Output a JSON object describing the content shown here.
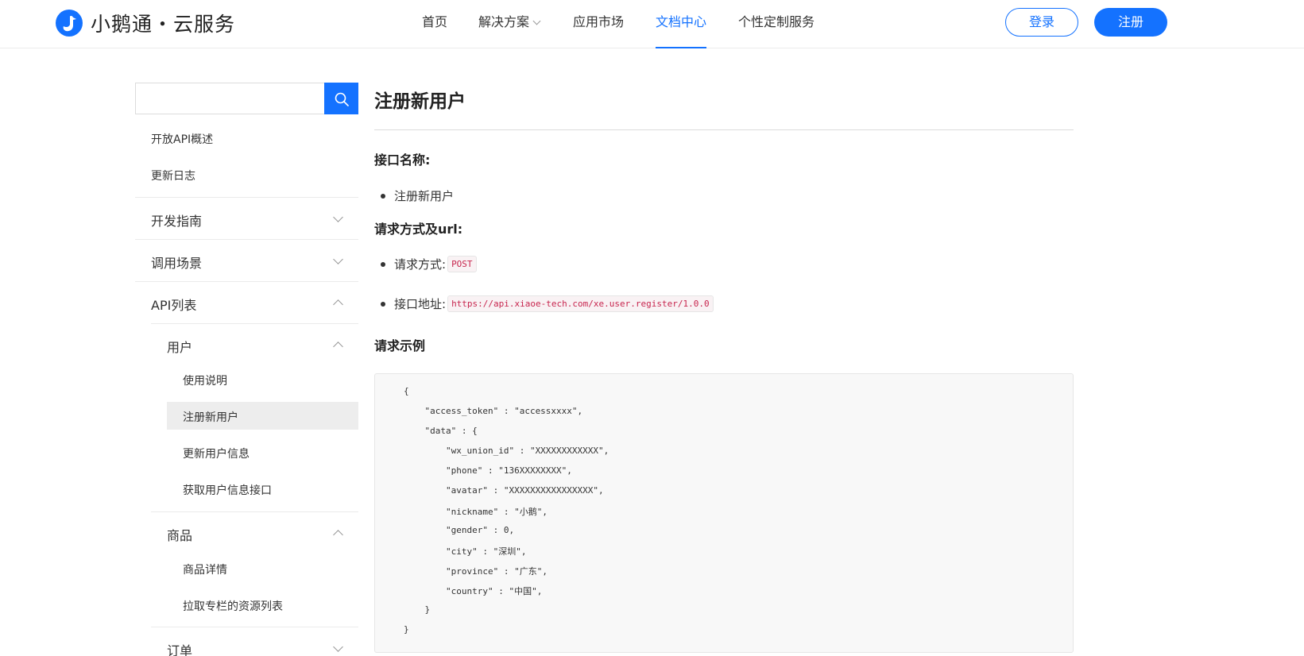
{
  "header": {
    "brand": "小鹅通・云服务",
    "nav": [
      {
        "label": "首页"
      },
      {
        "label": "解决方案"
      },
      {
        "label": "应用市场"
      },
      {
        "label": "文档中心"
      },
      {
        "label": "个性定制服务"
      }
    ],
    "active_nav": "文档中心",
    "login_label": "登录",
    "register_label": "注册",
    "accent_color": "#1472ff"
  },
  "sidebar": {
    "search": {
      "placeholder": "",
      "value": ""
    },
    "top_links": [
      {
        "label": "开放API概述"
      },
      {
        "label": "更新日志"
      }
    ],
    "groups": [
      {
        "label": "开发指南",
        "expanded": false
      },
      {
        "label": "调用场景",
        "expanded": false
      },
      {
        "label": "API列表",
        "expanded": true
      }
    ],
    "api_sections": [
      {
        "label": "用户",
        "expanded": true,
        "items": [
          "使用说明",
          "注册新用户",
          "更新用户信息",
          "获取用户信息接口"
        ]
      },
      {
        "label": "商品",
        "expanded": true,
        "items": [
          "商品详情",
          "拉取专栏的资源列表"
        ]
      },
      {
        "label": "订单",
        "expanded": false,
        "items": []
      }
    ],
    "active_item": "注册新用户"
  },
  "main": {
    "title": "注册新用户",
    "section_name_heading": "接口名称:",
    "interface_name": "注册新用户",
    "section_method_heading": "请求方式及url:",
    "method_label": "请求方式:",
    "method_value": "POST",
    "url_label": "接口地址:",
    "url_value": "https://api.xiaoe-tech.com/xe.user.register/1.0.0",
    "example_heading": "请求示例",
    "code_lines": [
      "{",
      "    \"access_token\" : \"accessxxxx\",",
      "    \"data\" : {",
      "        \"wx_union_id\" : \"XXXXXXXXXXXX\",",
      "        \"phone\" : \"136XXXXXXXX\",",
      "        \"avatar\" : \"XXXXXXXXXXXXXXXX\",",
      "        \"nickname\" : \"小鹅\",",
      "        \"gender\" : 0,",
      "        \"city\" : \"深圳\",",
      "        \"province\" : \"广东\",",
      "        \"country\" : \"中国\",",
      "    }",
      "}"
    ]
  }
}
